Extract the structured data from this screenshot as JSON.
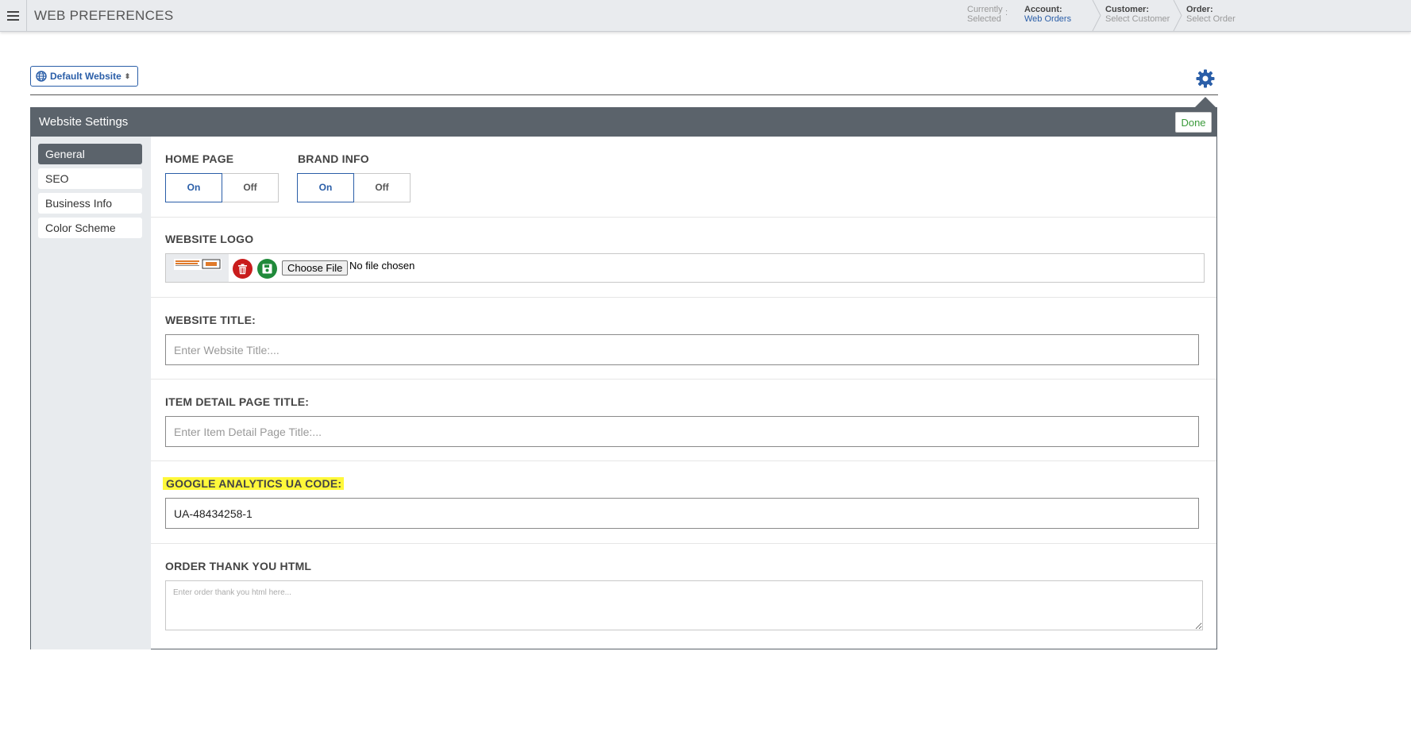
{
  "header": {
    "title": "WEB PREFERENCES",
    "currently_line1": "Currently",
    "currently_line2": "Selected",
    "colon": ":",
    "account": {
      "label": "Account:",
      "value": "Web Orders"
    },
    "customer": {
      "label": "Customer:",
      "value": "Select Customer"
    },
    "order": {
      "label": "Order:",
      "value": "Select Order"
    }
  },
  "website_selector": {
    "label": "Default Website",
    "arrow": "⬍"
  },
  "panel": {
    "title": "Website Settings",
    "done_label": "Done"
  },
  "sidebar": {
    "items": [
      {
        "label": "General",
        "active": true
      },
      {
        "label": "SEO",
        "active": false
      },
      {
        "label": "Business Info",
        "active": false
      },
      {
        "label": "Color Scheme",
        "active": false
      }
    ]
  },
  "form": {
    "home_page": {
      "label": "HOME PAGE",
      "on": "On",
      "off": "Off",
      "value": "On"
    },
    "brand_info": {
      "label": "BRAND INFO",
      "on": "On",
      "off": "Off",
      "value": "On"
    },
    "website_logo": {
      "label": "WEBSITE LOGO",
      "choose_file": "Choose File",
      "file_status": "No file chosen"
    },
    "website_title": {
      "label": "WEBSITE TITLE:",
      "placeholder": "Enter Website Title:...",
      "value": ""
    },
    "item_detail_title": {
      "label": "ITEM DETAIL PAGE TITLE:",
      "placeholder": "Enter Item Detail Page Title:...",
      "value": ""
    },
    "ga_code": {
      "label": "GOOGLE ANALYTICS UA CODE:",
      "placeholder": "",
      "value": "UA-48434258-1"
    },
    "thank_you_html": {
      "label": "ORDER THANK YOU HTML",
      "placeholder": "Enter order thank you html here...",
      "value": ""
    }
  },
  "colors": {
    "accent": "#2a5ea8",
    "panel_header": "#5b636b",
    "done_text": "#3a9a3a",
    "delete": "#c91c1c",
    "save": "#208a3a",
    "highlight": "#fff83a"
  },
  "icons": {
    "menu": "hamburger-icon",
    "globe": "globe-icon",
    "settings": "gear-icon",
    "delete": "trash-icon",
    "save": "floppy-icon"
  }
}
